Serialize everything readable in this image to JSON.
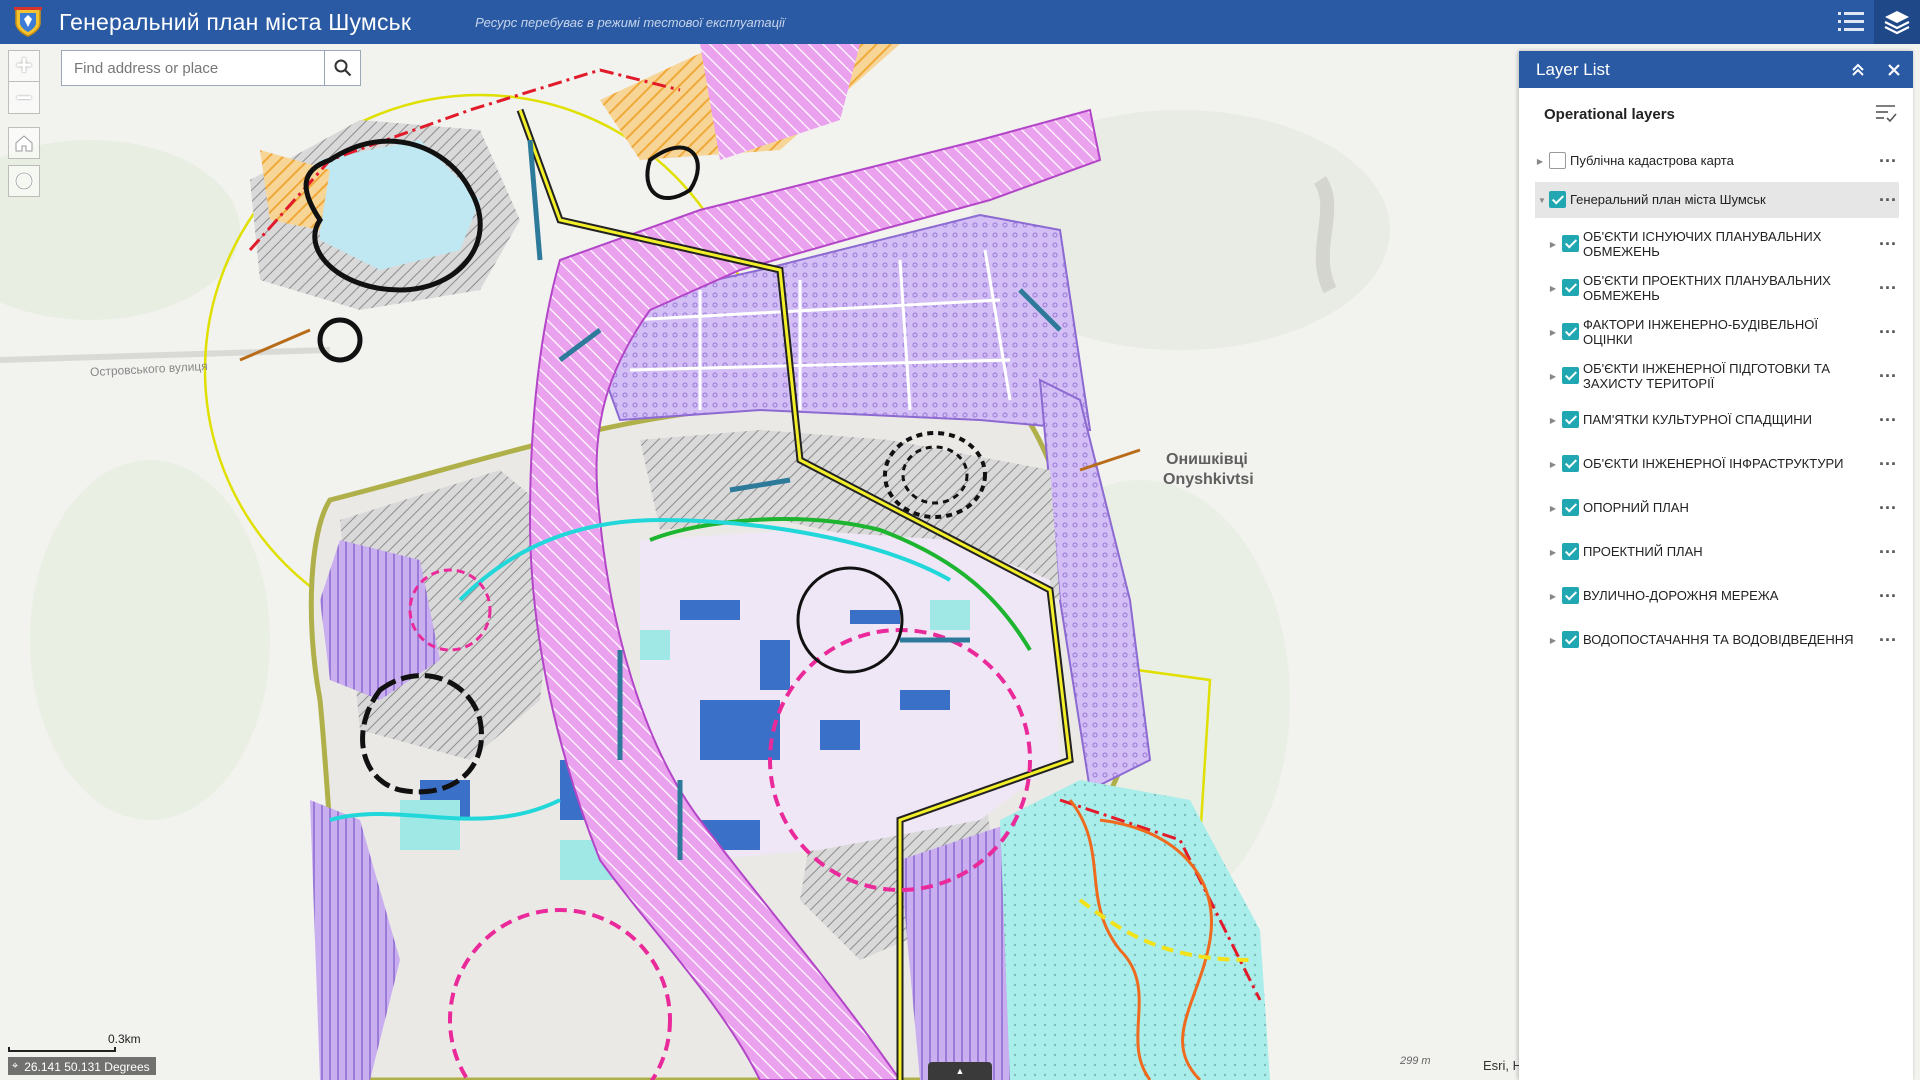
{
  "header": {
    "title": "Генеральний план міста Шумськ",
    "subtitle": "Ресурс перебуває в режимі тестової експлуатації"
  },
  "search": {
    "placeholder": "Find address or place"
  },
  "zoom": {
    "in": "+",
    "out": "–"
  },
  "map": {
    "place_label_uk": "Онишківці",
    "place_label_en": "Onyshkivtsi",
    "street_label": "Островського вулиця",
    "scale_label": "0.3km",
    "coordinates": "26.141 50.131 Degrees",
    "attribution": "Esri, H",
    "scale_hint": "299 m",
    "colors": {
      "zone_violet": "#c9aef0",
      "zone_magenta": "#e59ae8",
      "zone_orange": "#f0a838",
      "zone_cyan": "#9fe8e6",
      "hatch_grey": "#9b9b9b",
      "accent_blue": "#2a5aa4"
    }
  },
  "layer_list": {
    "title": "Layer List",
    "section": "Operational layers",
    "layers": [
      {
        "label": "Публічна кадастрова карта",
        "checked": false,
        "level": 0
      },
      {
        "label": "Генеральний план міста Шумськ",
        "checked": true,
        "level": 0
      },
      {
        "label": "ОБ'ЄКТИ ІСНУЮЧИХ ПЛАНУВАЛЬНИХ ОБМЕЖЕНЬ",
        "checked": true,
        "level": 1
      },
      {
        "label": "ОБ'ЄКТИ ПРОЕКТНИХ ПЛАНУВАЛЬНИХ ОБМЕЖЕНЬ",
        "checked": true,
        "level": 1
      },
      {
        "label": "ФАКТОРИ ІНЖЕНЕРНО-БУДІВЕЛЬНОЇ ОЦІНКИ",
        "checked": true,
        "level": 1
      },
      {
        "label": "ОБ'ЄКТИ ІНЖЕНЕРНОЇ ПІДГОТОВКИ ТА ЗАХИСТУ ТЕРИТОРІЇ",
        "checked": true,
        "level": 1
      },
      {
        "label": "ПАМ'ЯТКИ КУЛЬТУРНОЇ СПАДЩИНИ",
        "checked": true,
        "level": 1
      },
      {
        "label": "ОБ'ЄКТИ ІНЖЕНЕРНОЇ ІНФРАСТРУКТУРИ",
        "checked": true,
        "level": 1
      },
      {
        "label": "ОПОРНИЙ ПЛАН",
        "checked": true,
        "level": 1
      },
      {
        "label": "ПРОЕКТНИЙ ПЛАН",
        "checked": true,
        "level": 1
      },
      {
        "label": "ВУЛИЧНО-ДОРОЖНЯ МЕРЕЖА",
        "checked": true,
        "level": 1
      },
      {
        "label": "ВОДОПОСТАЧАННЯ ТА ВОДОВІДВЕДЕННЯ",
        "checked": true,
        "level": 1
      }
    ]
  }
}
